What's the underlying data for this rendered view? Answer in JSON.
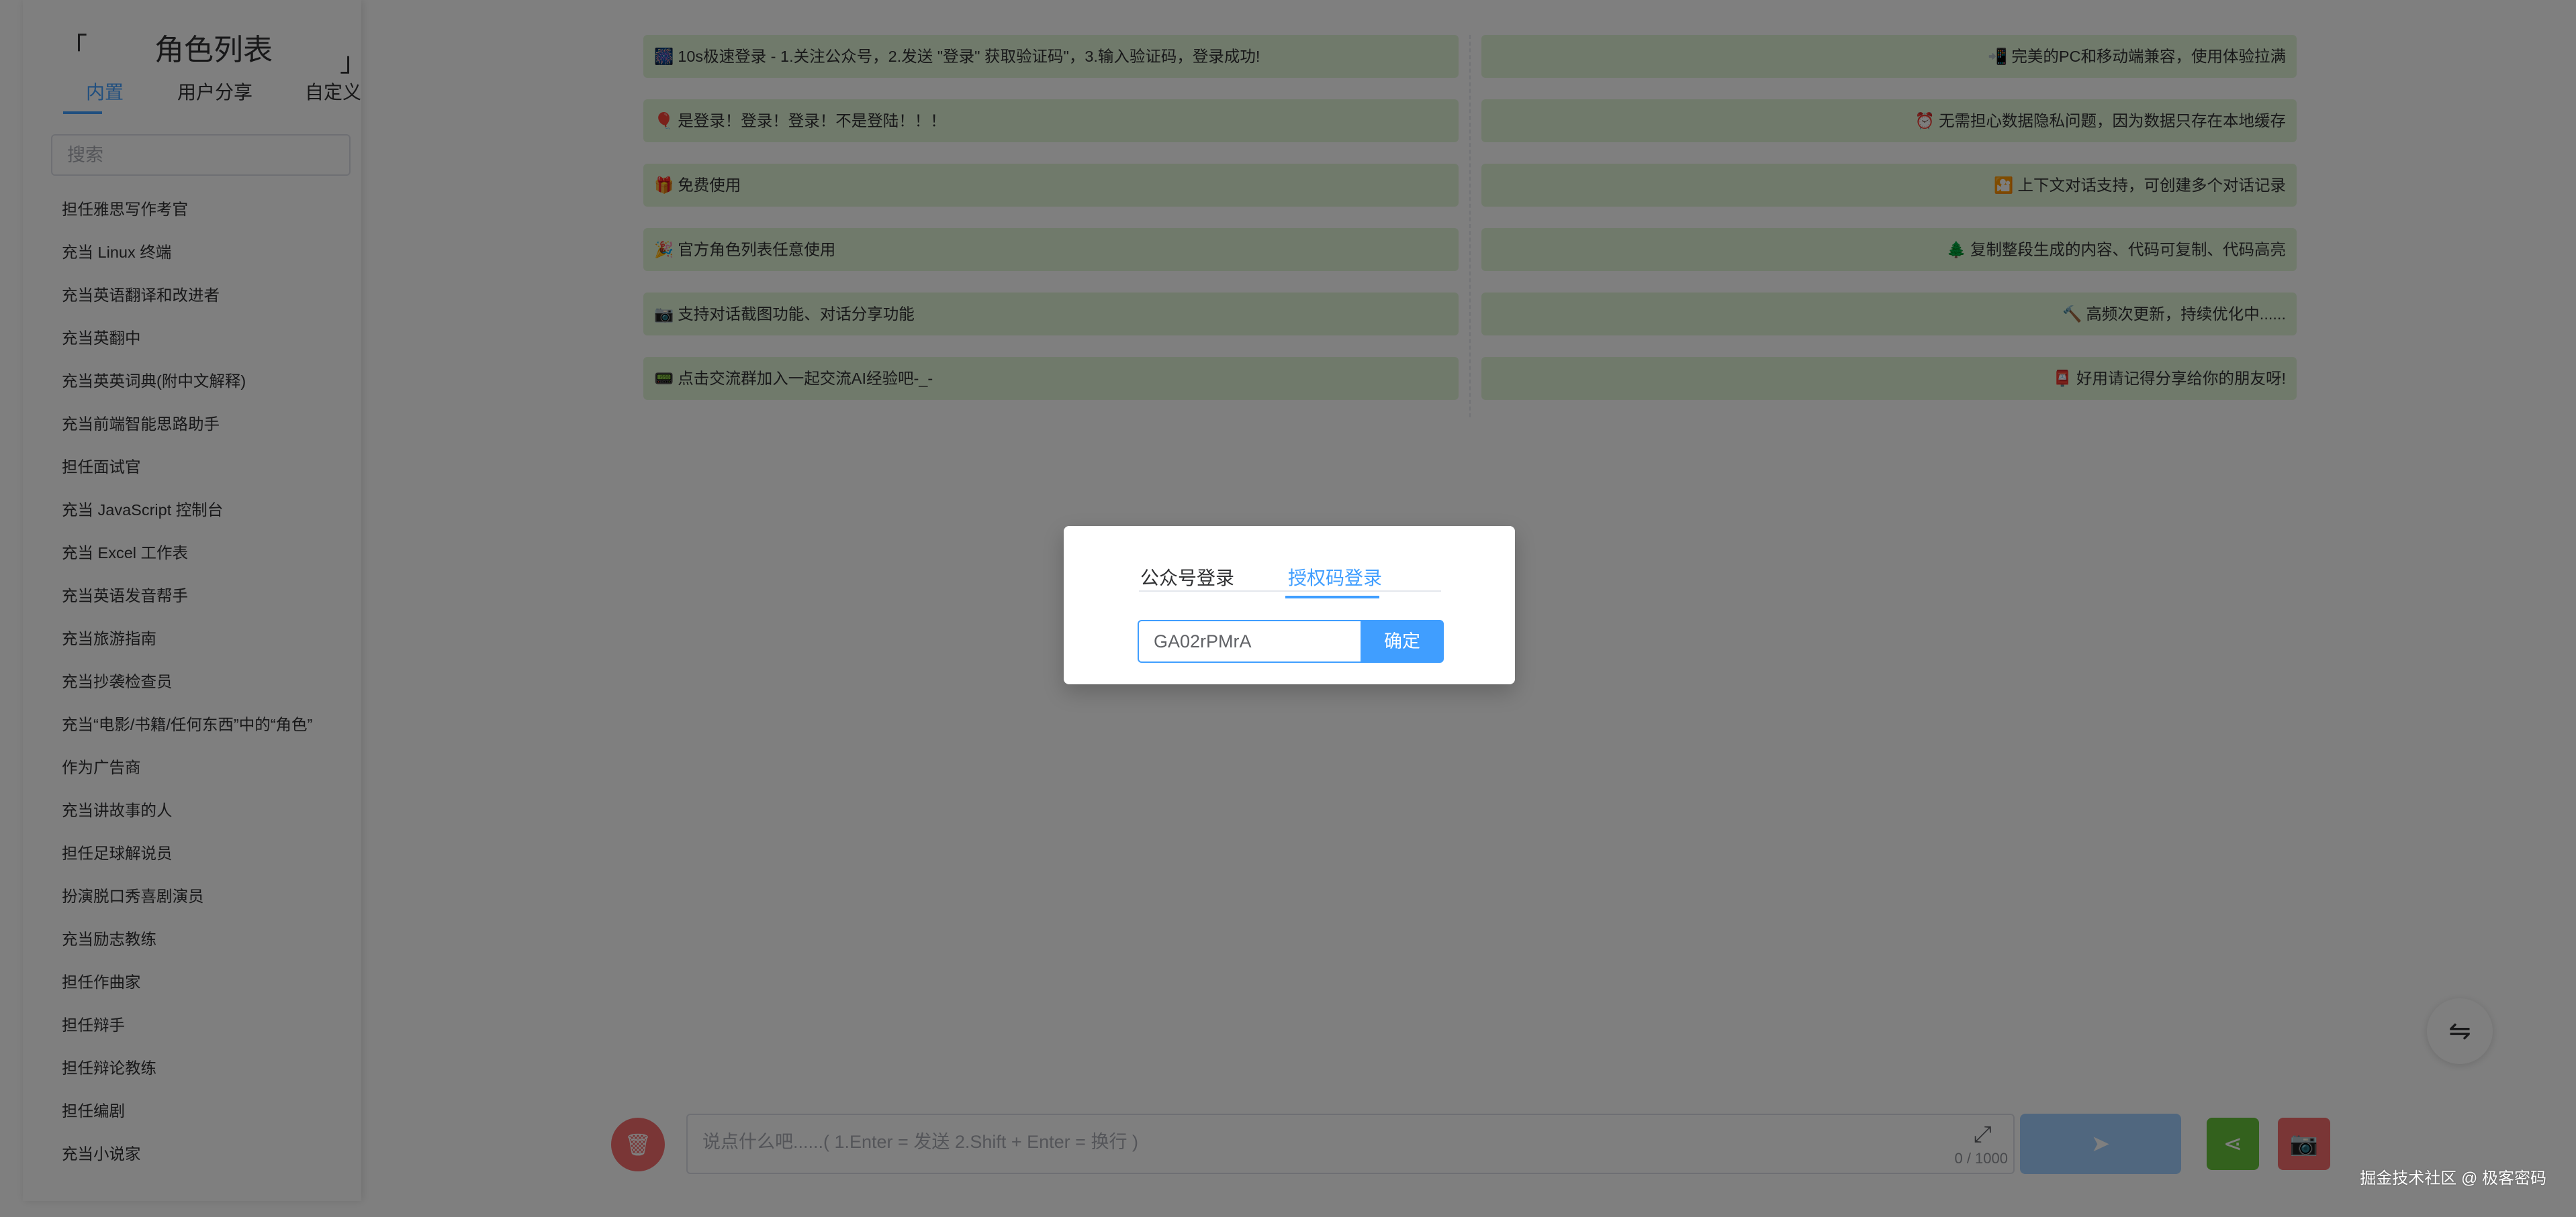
{
  "sidebar": {
    "bracket_left": "「",
    "bracket_right": "」",
    "title": "角色列表",
    "tabs": [
      {
        "label": "内置"
      },
      {
        "label": "用户分享"
      },
      {
        "label": "自定义"
      }
    ],
    "search_placeholder": "搜索",
    "items": [
      {
        "label": "担任雅思写作考官"
      },
      {
        "label": "充当 Linux 终端"
      },
      {
        "label": "充当英语翻译和改进者"
      },
      {
        "label": "充当英翻中"
      },
      {
        "label": "充当英英词典(附中文解释)"
      },
      {
        "label": "充当前端智能思路助手"
      },
      {
        "label": "担任面试官"
      },
      {
        "label": "充当 JavaScript 控制台"
      },
      {
        "label": "充当 Excel 工作表"
      },
      {
        "label": "充当英语发音帮手"
      },
      {
        "label": "充当旅游指南"
      },
      {
        "label": "充当抄袭检查员"
      },
      {
        "label": "充当“电影/书籍/任何东西”中的“角色”"
      },
      {
        "label": "作为广告商"
      },
      {
        "label": "充当讲故事的人"
      },
      {
        "label": "担任足球解说员"
      },
      {
        "label": "扮演脱口秀喜剧演员"
      },
      {
        "label": "充当励志教练"
      },
      {
        "label": "担任作曲家"
      },
      {
        "label": "担任辩手"
      },
      {
        "label": "担任辩论教练"
      },
      {
        "label": "担任编剧"
      },
      {
        "label": "充当小说家"
      }
    ]
  },
  "features": {
    "left": [
      {
        "emoji": "🎆",
        "text": "10s极速登录 - 1.关注公众号，2.发送 \"登录\" 获取验证码\"，3.输入验证码，登录成功!"
      },
      {
        "emoji": "🎈",
        "text": "是登录！登录！登录！不是登陆！！！"
      },
      {
        "emoji": "🎁",
        "text": "免费使用"
      },
      {
        "emoji": "🎉",
        "text": "官方角色列表任意使用"
      },
      {
        "emoji": "📷",
        "text": "支持对话截图功能、对话分享功能"
      },
      {
        "emoji": "📟",
        "text": "点击交流群加入一起交流AI经验吧-_-"
      }
    ],
    "right": [
      {
        "emoji": "📲",
        "text": "完美的PC和移动端兼容，使用体验拉满"
      },
      {
        "emoji": "⏰",
        "text": "无需担心数据隐私问题，因为数据只存在本地缓存"
      },
      {
        "emoji": "🎦",
        "text": "上下文对话支持，可创建多个对话记录"
      },
      {
        "emoji": "🌲",
        "text": "复制整段生成的内容、代码可复制、代码高亮"
      },
      {
        "emoji": "🔨",
        "text": "高频次更新，持续优化中......"
      },
      {
        "emoji": "📮",
        "text": "好用请记得分享给你的朋友呀!"
      }
    ]
  },
  "input_bar": {
    "placeholder": "说点什么吧......( 1.Enter = 发送   2.Shift + Enter = 换行 )",
    "counter": "0 / 1000",
    "trash_icon": "🗑",
    "expand_icon": "⤢",
    "send_icon": "➤",
    "share_icon": "⋖",
    "camera_icon": "📷",
    "swap_icon": "⇋"
  },
  "login_dialog": {
    "tabs": [
      {
        "label": "公众号登录"
      },
      {
        "label": "授权码登录"
      }
    ],
    "active_tab": "授权码登录",
    "code_value": "GA02rPMrA",
    "confirm_label": "确定"
  },
  "watermark": "掘金技术社区 @ 极客密码",
  "colors": {
    "accent": "#409eff",
    "card_bg": "#e1f4d7",
    "danger": "#f56c6c",
    "success": "#67c23a",
    "overlay": "rgba(0,0,0,0.5)"
  }
}
